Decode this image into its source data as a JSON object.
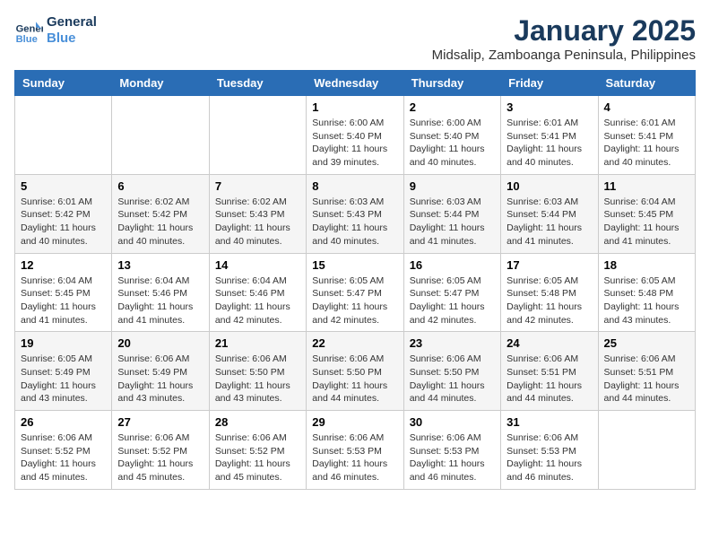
{
  "header": {
    "logo_line1": "General",
    "logo_line2": "Blue",
    "title": "January 2025",
    "subtitle": "Midsalip, Zamboanga Peninsula, Philippines"
  },
  "weekdays": [
    "Sunday",
    "Monday",
    "Tuesday",
    "Wednesday",
    "Thursday",
    "Friday",
    "Saturday"
  ],
  "weeks": [
    [
      {
        "day": "",
        "info": ""
      },
      {
        "day": "",
        "info": ""
      },
      {
        "day": "",
        "info": ""
      },
      {
        "day": "1",
        "info": "Sunrise: 6:00 AM\nSunset: 5:40 PM\nDaylight: 11 hours\nand 39 minutes."
      },
      {
        "day": "2",
        "info": "Sunrise: 6:00 AM\nSunset: 5:40 PM\nDaylight: 11 hours\nand 40 minutes."
      },
      {
        "day": "3",
        "info": "Sunrise: 6:01 AM\nSunset: 5:41 PM\nDaylight: 11 hours\nand 40 minutes."
      },
      {
        "day": "4",
        "info": "Sunrise: 6:01 AM\nSunset: 5:41 PM\nDaylight: 11 hours\nand 40 minutes."
      }
    ],
    [
      {
        "day": "5",
        "info": "Sunrise: 6:01 AM\nSunset: 5:42 PM\nDaylight: 11 hours\nand 40 minutes."
      },
      {
        "day": "6",
        "info": "Sunrise: 6:02 AM\nSunset: 5:42 PM\nDaylight: 11 hours\nand 40 minutes."
      },
      {
        "day": "7",
        "info": "Sunrise: 6:02 AM\nSunset: 5:43 PM\nDaylight: 11 hours\nand 40 minutes."
      },
      {
        "day": "8",
        "info": "Sunrise: 6:03 AM\nSunset: 5:43 PM\nDaylight: 11 hours\nand 40 minutes."
      },
      {
        "day": "9",
        "info": "Sunrise: 6:03 AM\nSunset: 5:44 PM\nDaylight: 11 hours\nand 41 minutes."
      },
      {
        "day": "10",
        "info": "Sunrise: 6:03 AM\nSunset: 5:44 PM\nDaylight: 11 hours\nand 41 minutes."
      },
      {
        "day": "11",
        "info": "Sunrise: 6:04 AM\nSunset: 5:45 PM\nDaylight: 11 hours\nand 41 minutes."
      }
    ],
    [
      {
        "day": "12",
        "info": "Sunrise: 6:04 AM\nSunset: 5:45 PM\nDaylight: 11 hours\nand 41 minutes."
      },
      {
        "day": "13",
        "info": "Sunrise: 6:04 AM\nSunset: 5:46 PM\nDaylight: 11 hours\nand 41 minutes."
      },
      {
        "day": "14",
        "info": "Sunrise: 6:04 AM\nSunset: 5:46 PM\nDaylight: 11 hours\nand 42 minutes."
      },
      {
        "day": "15",
        "info": "Sunrise: 6:05 AM\nSunset: 5:47 PM\nDaylight: 11 hours\nand 42 minutes."
      },
      {
        "day": "16",
        "info": "Sunrise: 6:05 AM\nSunset: 5:47 PM\nDaylight: 11 hours\nand 42 minutes."
      },
      {
        "day": "17",
        "info": "Sunrise: 6:05 AM\nSunset: 5:48 PM\nDaylight: 11 hours\nand 42 minutes."
      },
      {
        "day": "18",
        "info": "Sunrise: 6:05 AM\nSunset: 5:48 PM\nDaylight: 11 hours\nand 43 minutes."
      }
    ],
    [
      {
        "day": "19",
        "info": "Sunrise: 6:05 AM\nSunset: 5:49 PM\nDaylight: 11 hours\nand 43 minutes."
      },
      {
        "day": "20",
        "info": "Sunrise: 6:06 AM\nSunset: 5:49 PM\nDaylight: 11 hours\nand 43 minutes."
      },
      {
        "day": "21",
        "info": "Sunrise: 6:06 AM\nSunset: 5:50 PM\nDaylight: 11 hours\nand 43 minutes."
      },
      {
        "day": "22",
        "info": "Sunrise: 6:06 AM\nSunset: 5:50 PM\nDaylight: 11 hours\nand 44 minutes."
      },
      {
        "day": "23",
        "info": "Sunrise: 6:06 AM\nSunset: 5:50 PM\nDaylight: 11 hours\nand 44 minutes."
      },
      {
        "day": "24",
        "info": "Sunrise: 6:06 AM\nSunset: 5:51 PM\nDaylight: 11 hours\nand 44 minutes."
      },
      {
        "day": "25",
        "info": "Sunrise: 6:06 AM\nSunset: 5:51 PM\nDaylight: 11 hours\nand 44 minutes."
      }
    ],
    [
      {
        "day": "26",
        "info": "Sunrise: 6:06 AM\nSunset: 5:52 PM\nDaylight: 11 hours\nand 45 minutes."
      },
      {
        "day": "27",
        "info": "Sunrise: 6:06 AM\nSunset: 5:52 PM\nDaylight: 11 hours\nand 45 minutes."
      },
      {
        "day": "28",
        "info": "Sunrise: 6:06 AM\nSunset: 5:52 PM\nDaylight: 11 hours\nand 45 minutes."
      },
      {
        "day": "29",
        "info": "Sunrise: 6:06 AM\nSunset: 5:53 PM\nDaylight: 11 hours\nand 46 minutes."
      },
      {
        "day": "30",
        "info": "Sunrise: 6:06 AM\nSunset: 5:53 PM\nDaylight: 11 hours\nand 46 minutes."
      },
      {
        "day": "31",
        "info": "Sunrise: 6:06 AM\nSunset: 5:53 PM\nDaylight: 11 hours\nand 46 minutes."
      },
      {
        "day": "",
        "info": ""
      }
    ]
  ]
}
